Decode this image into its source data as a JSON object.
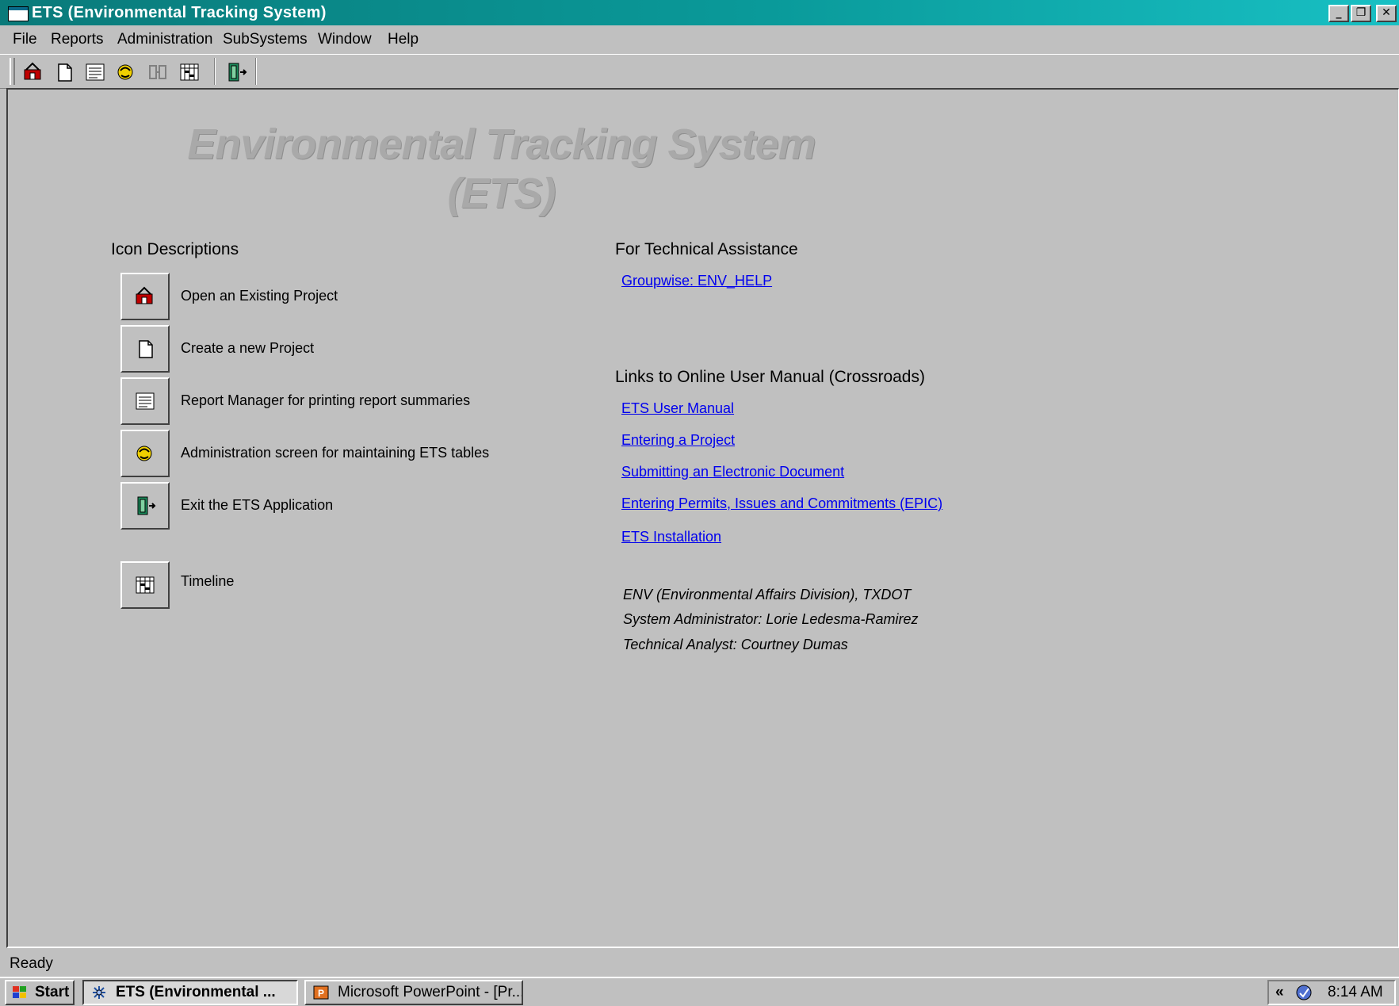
{
  "window": {
    "title": "ETS (Environmental Tracking System)",
    "controls": {
      "minimize": "_",
      "restore": "❐",
      "close": "✕"
    }
  },
  "menu": [
    "File",
    "Reports",
    "Administration",
    "SubSystems",
    "Window",
    "Help"
  ],
  "toolbar": {
    "icons": [
      "open-project-icon",
      "new-project-icon",
      "report-manager-icon",
      "administration-icon",
      "subsystems-icon",
      "timeline-icon",
      "exit-icon"
    ]
  },
  "banner": {
    "line1": "Environmental Tracking System",
    "line2": "(ETS)"
  },
  "icon_descriptions": {
    "title": "Icon Descriptions",
    "items": [
      {
        "icon": "open-project-icon",
        "label": "Open an Existing Project"
      },
      {
        "icon": "new-project-icon",
        "label": "Create a new Project"
      },
      {
        "icon": "report-manager-icon",
        "label": "Report Manager for printing report summaries"
      },
      {
        "icon": "administration-icon",
        "label": "Administration screen for maintaining ETS tables"
      },
      {
        "icon": "exit-icon",
        "label": "Exit the ETS Application"
      },
      {
        "icon": "timeline-icon",
        "label": "Timeline"
      }
    ]
  },
  "technical_assistance": {
    "title": "For Technical Assistance",
    "link": "Groupwise: ENV_HELP"
  },
  "manual_links": {
    "title": "Links to Online User Manual (Crossroads)",
    "links": [
      "ETS User Manual",
      "Entering a Project",
      "Submitting an Electronic Document",
      "Entering Permits, Issues and Commitments (EPIC)",
      "ETS Installation"
    ]
  },
  "credits": [
    "ENV (Environmental Affairs Division), TXDOT",
    "System Administrator: Lorie Ledesma-Ramirez",
    "Technical Analyst: Courtney Dumas"
  ],
  "status": "Ready",
  "taskbar": {
    "start": "Start",
    "tasks": [
      "ETS (Environmental ...",
      "Microsoft PowerPoint - [Pr..."
    ],
    "tray_chevron": "«",
    "clock": "8:14 AM"
  },
  "colors": {
    "link": "#0000ee",
    "titlebar": "#0a8a8a",
    "face": "#c0c0c0",
    "banner": "#a9a9a9"
  }
}
